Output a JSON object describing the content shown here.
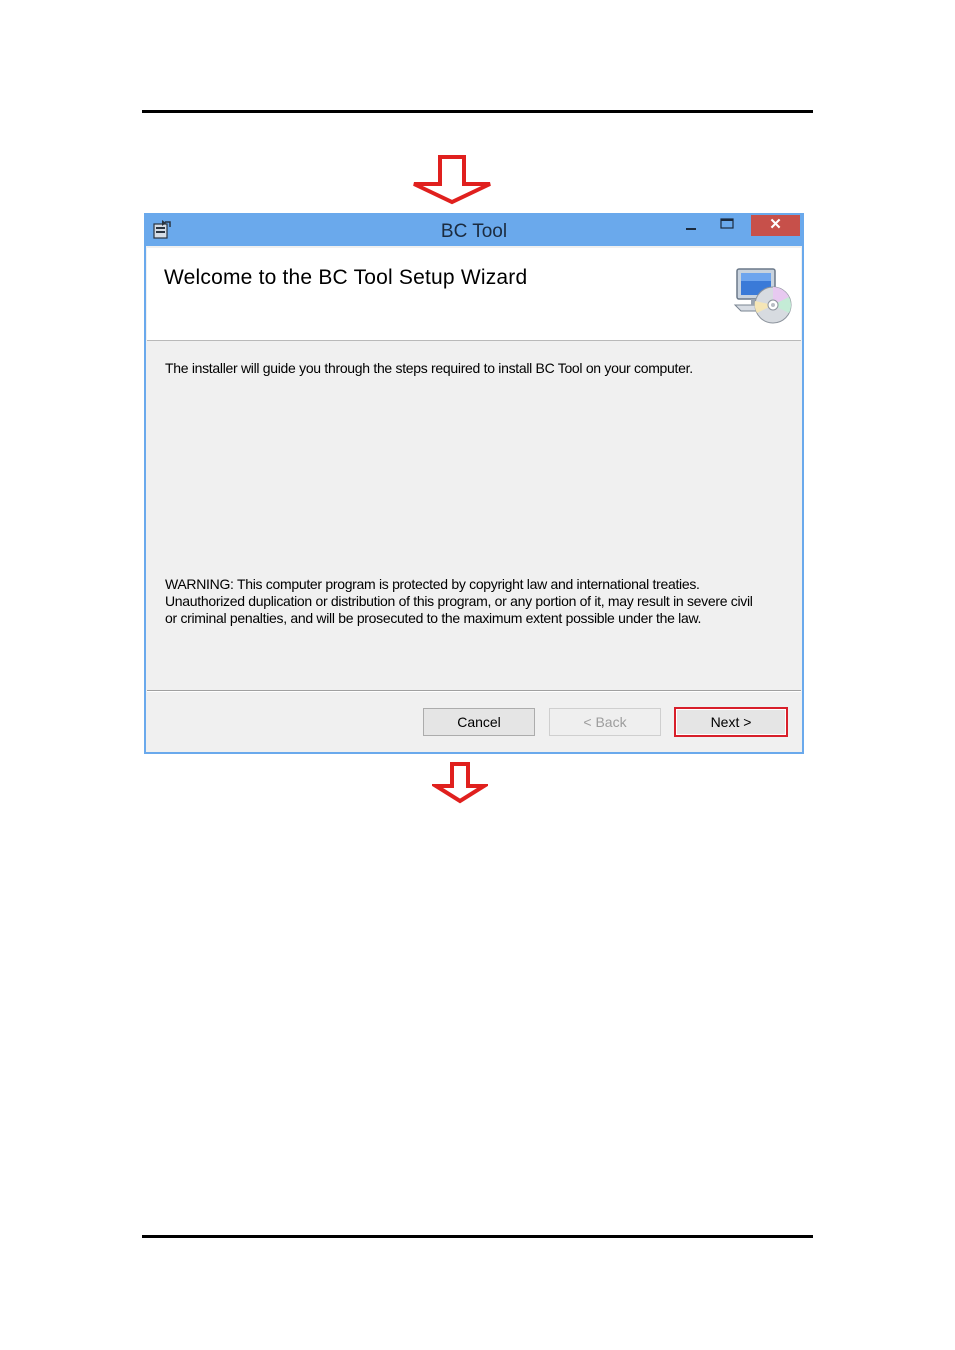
{
  "window": {
    "title": "BC Tool",
    "close_glyph": "✕",
    "header_title": "Welcome to the BC Tool Setup Wizard",
    "intro_text": "The installer will guide you through the steps required to install BC Tool on your computer.",
    "warning_lines": [
      "WARNING: This computer program is protected by copyright law and international treaties.",
      "Unauthorized duplication or distribution of this program, or any portion of it, may result in severe civil",
      "or criminal penalties, and will be prosecuted to the maximum extent possible under the law."
    ],
    "buttons": {
      "cancel": "Cancel",
      "back": "< Back",
      "next": "Next >"
    }
  },
  "icons": {
    "app": "installer-icon",
    "header": "computer-cd-icon",
    "arrows": "red-down-arrow-icon"
  },
  "colors": {
    "titlebar": "#6aa9ec",
    "close": "#c7504a",
    "highlight": "#d81f2a"
  }
}
